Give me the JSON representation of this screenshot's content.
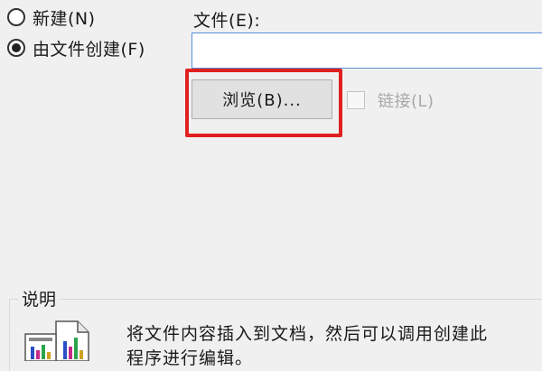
{
  "options": {
    "new_label": "新建(N)",
    "from_file_label": "由文件创建(F)",
    "selected": "from_file"
  },
  "file": {
    "label": "文件(E):",
    "value": ""
  },
  "browse": {
    "label": "浏览(B)..."
  },
  "link": {
    "label": "链接(L)",
    "checked": false,
    "enabled": false
  },
  "description": {
    "title": "说明",
    "line1": "将文件内容插入到文档，然后可以调用创建此",
    "line2": "程序进行编辑。"
  },
  "colors": {
    "highlight": "#e0201f",
    "input_border": "#5a8fd8"
  },
  "icons": {
    "document": "document-chart-icon"
  }
}
